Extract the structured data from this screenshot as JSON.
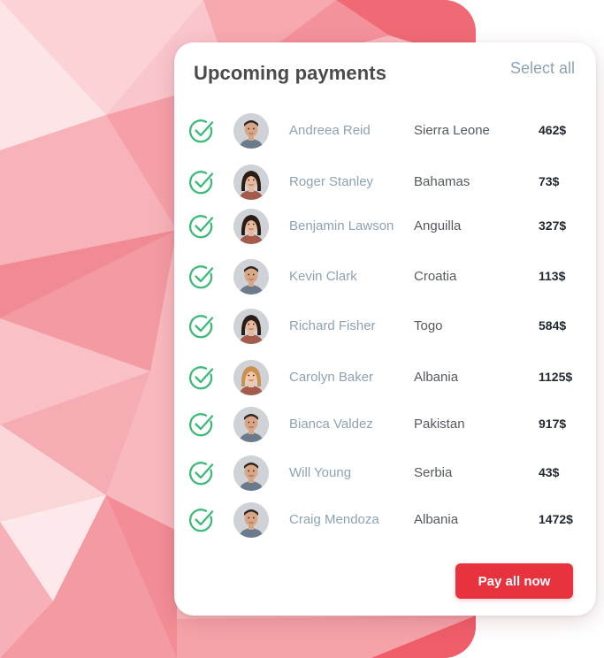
{
  "card": {
    "title": "Upcoming payments",
    "select_all_label": "Select all",
    "pay_button_label": "Pay all now"
  },
  "colors": {
    "accent": "#e8333e",
    "check": "#3db979",
    "name_text": "#8ea2b4",
    "background_pink": "#f6a3aa"
  },
  "payments": [
    {
      "name": "Andreea Reid",
      "country": "Sierra Leone",
      "amount": "462$",
      "status_icon": "check-circle-icon",
      "avatar": "male"
    },
    {
      "name": "Roger Stanley",
      "country": "Bahamas",
      "amount": "73$",
      "status_icon": "check-circle-icon",
      "avatar": "female"
    },
    {
      "name": "Benjamin Lawson",
      "country": "Anguilla",
      "amount": "327$",
      "status_icon": "check-circle-icon",
      "avatar": "female"
    },
    {
      "name": "Kevin Clark",
      "country": "Croatia",
      "amount": "113$",
      "status_icon": "check-circle-icon",
      "avatar": "male"
    },
    {
      "name": "Richard Fisher",
      "country": "Togo",
      "amount": "584$",
      "status_icon": "check-circle-icon",
      "avatar": "female"
    },
    {
      "name": "Carolyn Baker",
      "country": "Albania",
      "amount": "1125$",
      "status_icon": "check-circle-icon",
      "avatar": "female-blonde"
    },
    {
      "name": "Bianca Valdez",
      "country": "Pakistan",
      "amount": "917$",
      "status_icon": "check-circle-icon",
      "avatar": "male"
    },
    {
      "name": "Will Young",
      "country": "Serbia",
      "amount": "43$",
      "status_icon": "check-circle-icon",
      "avatar": "male"
    },
    {
      "name": "Craig Mendoza",
      "country": "Albania",
      "amount": "1472$",
      "status_icon": "check-circle-icon",
      "avatar": "male"
    }
  ]
}
